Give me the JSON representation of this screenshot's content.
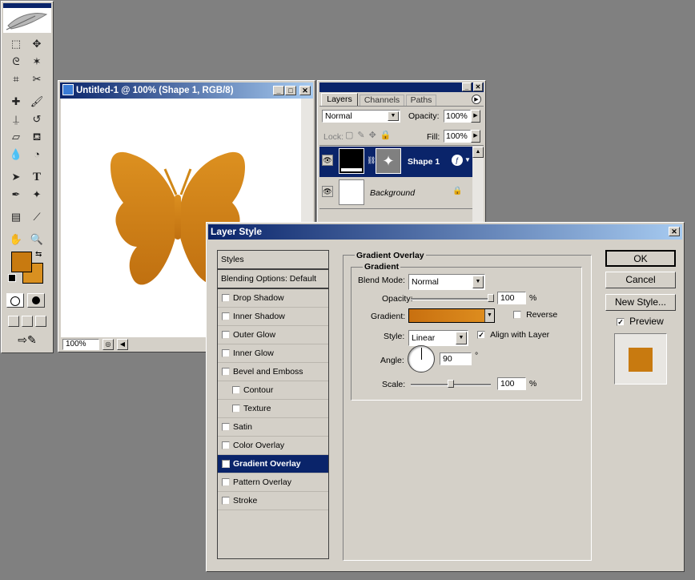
{
  "toolbox": {
    "tools": [
      "marquee-tool-icon",
      "move-tool-icon",
      "lasso-tool-icon",
      "magic-wand-tool-icon",
      "crop-tool-icon",
      "slice-tool-icon",
      "healing-brush-icon",
      "brush-tool-icon",
      "clone-stamp-icon",
      "history-brush-icon",
      "eraser-tool-icon",
      "paint-bucket-icon",
      "blur-tool-icon",
      "dodge-tool-icon",
      "path-selection-icon",
      "type-tool-icon",
      "pen-tool-icon",
      "custom-shape-icon",
      "notes-tool-icon",
      "eyedropper-icon",
      "hand-tool-icon",
      "zoom-tool-icon"
    ],
    "foreground_color": "#c87a10",
    "background_color": "#d99020"
  },
  "document": {
    "title": "Untitled-1 @ 100% (Shape 1, RGB/8)",
    "zoom": "100%",
    "shape_color_top": "#dc9020",
    "shape_color_bottom": "#c07010"
  },
  "layers_panel": {
    "tabs": [
      "Layers",
      "Channels",
      "Paths"
    ],
    "blend_mode": "Normal",
    "opacity_label": "Opacity:",
    "opacity": "100%",
    "lock_label": "Lock:",
    "fill_label": "Fill:",
    "fill": "100%",
    "layers": [
      {
        "name": "Shape 1",
        "selected": true
      },
      {
        "name": "Background",
        "selected": false
      }
    ]
  },
  "layer_style": {
    "title": "Layer Style",
    "styles_header": "Styles",
    "blending_options": "Blending Options: Default",
    "items": [
      {
        "label": "Drop Shadow",
        "checked": false,
        "sub": false
      },
      {
        "label": "Inner Shadow",
        "checked": false,
        "sub": false
      },
      {
        "label": "Outer Glow",
        "checked": false,
        "sub": false
      },
      {
        "label": "Inner Glow",
        "checked": false,
        "sub": false
      },
      {
        "label": "Bevel and Emboss",
        "checked": false,
        "sub": false
      },
      {
        "label": "Contour",
        "checked": false,
        "sub": true
      },
      {
        "label": "Texture",
        "checked": false,
        "sub": true
      },
      {
        "label": "Satin",
        "checked": false,
        "sub": false
      },
      {
        "label": "Color Overlay",
        "checked": false,
        "sub": false
      },
      {
        "label": "Gradient Overlay",
        "checked": true,
        "sub": false,
        "selected": true
      },
      {
        "label": "Pattern Overlay",
        "checked": false,
        "sub": false
      },
      {
        "label": "Stroke",
        "checked": false,
        "sub": false
      }
    ],
    "section_title": "Gradient Overlay",
    "group_title": "Gradient",
    "blend_mode_label": "Blend Mode:",
    "blend_mode": "Normal",
    "opacity_label": "Opacity:",
    "opacity": "100",
    "opacity_level": 1.0,
    "percent": "%",
    "gradient_label": "Gradient:",
    "gradient_start": "#c87010",
    "gradient_end": "#e09020",
    "reverse_label": "Reverse",
    "reverse_checked": false,
    "style_label": "Style:",
    "style": "Linear",
    "align_label": "Align with Layer",
    "align_checked": true,
    "angle_label": "Angle:",
    "angle": "90",
    "degree": "°",
    "scale_label": "Scale:",
    "scale": "100",
    "scale_level": 0.5,
    "ok": "OK",
    "cancel": "Cancel",
    "new_style": "New Style...",
    "preview_label": "Preview",
    "preview_checked": true,
    "preview_color": "#c87a10"
  }
}
